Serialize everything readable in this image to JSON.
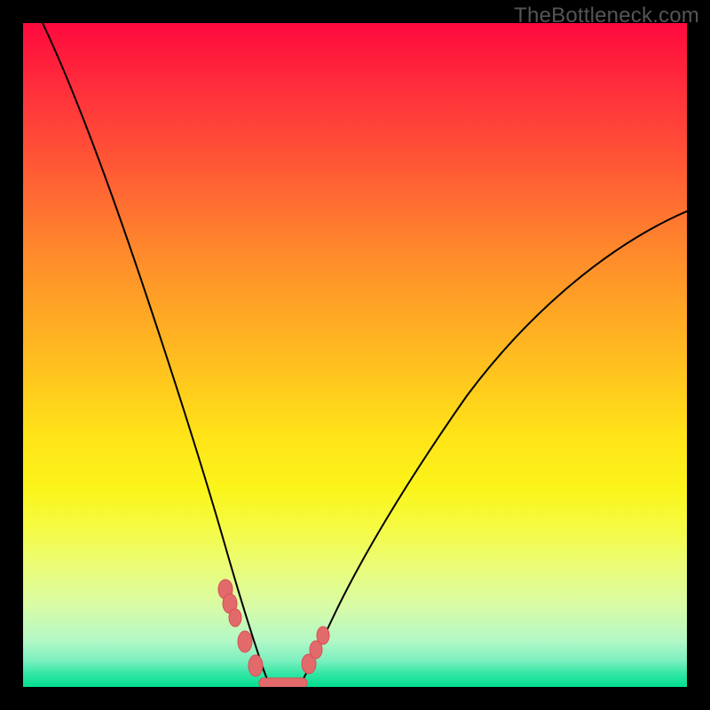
{
  "watermark": "TheBottleneck.com",
  "chart_data": {
    "type": "line",
    "title": "",
    "xlabel": "",
    "ylabel": "",
    "x_range_fraction": [
      0.0,
      1.0
    ],
    "y_range_percent": [
      0,
      100
    ],
    "background_gradient": {
      "orientation": "vertical",
      "stops": [
        {
          "pos": 0.0,
          "value": 100,
          "color": "#ff0a3e"
        },
        {
          "pos": 0.5,
          "value": 50,
          "color": "#ffc51e"
        },
        {
          "pos": 1.0,
          "value": 0,
          "color": "#00df8f"
        }
      ],
      "meaning": "high=red (bad/bottleneck) → low=green (good)"
    },
    "series": [
      {
        "name": "left-curve",
        "x": [
          0.03,
          0.08,
          0.13,
          0.18,
          0.23,
          0.27,
          0.3,
          0.33,
          0.35,
          0.365
        ],
        "y": [
          100,
          86,
          72,
          57,
          40,
          24,
          13,
          6,
          2,
          0
        ]
      },
      {
        "name": "right-curve",
        "x": [
          0.41,
          0.44,
          0.49,
          0.55,
          0.63,
          0.72,
          0.82,
          0.92,
          1.0
        ],
        "y": [
          0,
          4,
          11,
          21,
          32,
          44,
          55,
          64,
          70
        ]
      },
      {
        "name": "valley-flat",
        "x": [
          0.365,
          0.41
        ],
        "y": [
          0,
          0
        ]
      }
    ],
    "markers": {
      "description": "salmon beads clustered near the valley on both curves and along the flat bottom",
      "points": [
        {
          "x": 0.3,
          "y": 13
        },
        {
          "x": 0.31,
          "y": 11
        },
        {
          "x": 0.318,
          "y": 9
        },
        {
          "x": 0.332,
          "y": 6
        },
        {
          "x": 0.348,
          "y": 2
        },
        {
          "x": 0.43,
          "y": 3
        },
        {
          "x": 0.44,
          "y": 5
        },
        {
          "x": 0.45,
          "y": 7
        }
      ],
      "bottom_strip": {
        "x_start": 0.355,
        "x_end": 0.425,
        "y": 0
      }
    }
  }
}
